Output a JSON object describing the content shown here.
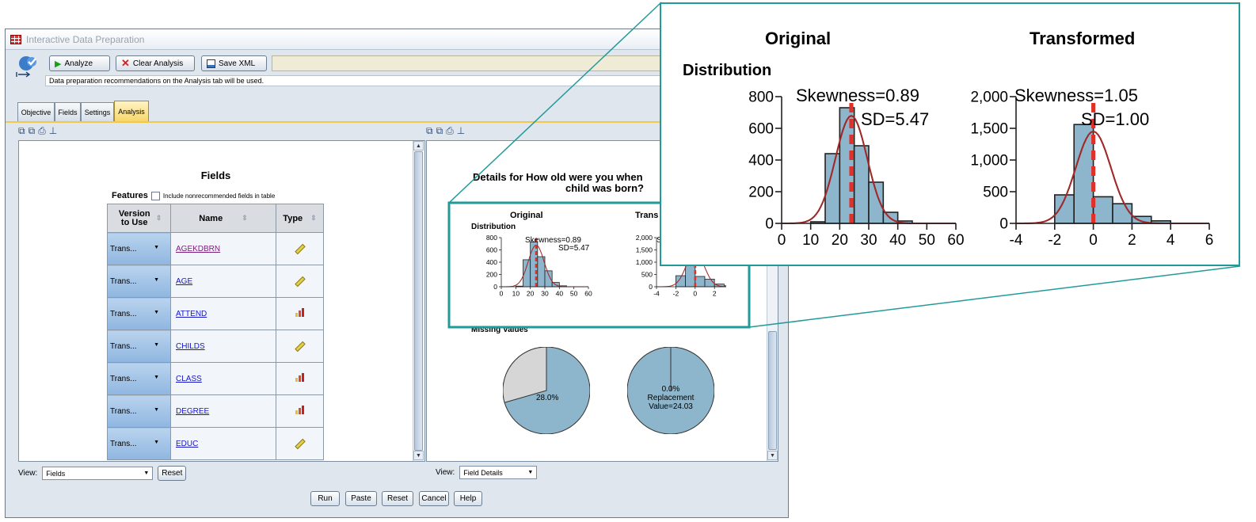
{
  "window": {
    "title": "Interactive Data Preparation"
  },
  "toolbar": {
    "analyze_label": "Analyze",
    "clear_label": "Clear Analysis",
    "save_label": "Save XML",
    "info_text": "Data preparation recommendations on the Analysis tab will be used."
  },
  "tabs": [
    {
      "label": "Objective"
    },
    {
      "label": "Fields"
    },
    {
      "label": "Settings"
    },
    {
      "label": "Analysis",
      "active": true
    }
  ],
  "left_panel": {
    "title": "Fields",
    "features_label": "Features",
    "include_label": "Include nonrecommended fields in table",
    "columns": [
      "Version to Use",
      "Name",
      "Type"
    ],
    "rows": [
      {
        "version": "Trans...",
        "name": "AGEKDBRN",
        "type": "ruler-icon",
        "visited": true
      },
      {
        "version": "Trans...",
        "name": "AGE",
        "type": "ruler-icon"
      },
      {
        "version": "Trans...",
        "name": "ATTEND",
        "type": "bar-chart-icon"
      },
      {
        "version": "Trans...",
        "name": "CHILDS",
        "type": "ruler-icon"
      },
      {
        "version": "Trans...",
        "name": "CLASS",
        "type": "bar-chart-icon"
      },
      {
        "version": "Trans...",
        "name": "DEGREE",
        "type": "bar-chart-icon"
      },
      {
        "version": "Trans...",
        "name": "EDUC",
        "type": "ruler-icon"
      }
    ],
    "view_label": "View:",
    "view_value": "Fields",
    "reset_label": "Reset"
  },
  "right_panel": {
    "details_title_line1": "Details for How old were you when",
    "details_title_line2": "child was born?",
    "original_label": "Original",
    "transformed_label": "Trans",
    "distribution_label": "Distribution",
    "missing_label": "Missing Values",
    "pie_original_label": "28.0%",
    "pie_transformed_label_1": "0.0%",
    "pie_transformed_label_2": "Replacement",
    "pie_transformed_label_3": "Value=24.03",
    "view_label": "View:",
    "view_value": "Field Details"
  },
  "footer": {
    "run": "Run",
    "paste": "Paste",
    "reset": "Reset",
    "cancel": "Cancel",
    "help": "Help"
  },
  "callout": {
    "original_title": "Original",
    "transformed_title": "Transformed",
    "distribution_label": "Distribution",
    "orig_skew": "Skewness=0.89",
    "orig_sd": "SD=5.47",
    "trans_skew": "Skewness=1.05",
    "trans_sd": "SD=1.00"
  },
  "chart_data": [
    {
      "type": "bar",
      "title": "Original",
      "x_ticks": [
        0,
        10,
        20,
        30,
        40,
        50,
        60
      ],
      "y_ticks": [
        0,
        200,
        400,
        600,
        800
      ],
      "bins": [
        [
          10,
          15,
          10
        ],
        [
          15,
          20,
          440
        ],
        [
          20,
          25,
          730
        ],
        [
          25,
          30,
          490
        ],
        [
          30,
          35,
          260
        ],
        [
          35,
          40,
          70
        ],
        [
          40,
          45,
          15
        ]
      ],
      "mean_line": 24,
      "annotations": [
        "Skewness=0.89",
        "SD=5.47"
      ]
    },
    {
      "type": "bar",
      "title": "Transformed",
      "x_ticks": [
        -4,
        -2,
        0,
        2,
        4,
        6
      ],
      "y_ticks": [
        "0",
        "500",
        "1,000",
        "1,500",
        "2,000"
      ],
      "bins": [
        [
          -2,
          -1,
          450
        ],
        [
          -1,
          0,
          1560
        ],
        [
          0,
          1,
          420
        ],
        [
          1,
          2,
          310
        ],
        [
          2,
          3,
          110
        ],
        [
          3,
          4,
          40
        ]
      ],
      "mean_line": 0,
      "annotations": [
        "Skewness=1.05",
        "SD=1.00"
      ]
    },
    {
      "type": "pie",
      "title": "Missing Values",
      "slices": [
        {
          "label": "28.0%",
          "value": 28
        },
        {
          "value": 72
        }
      ]
    },
    {
      "type": "pie",
      "slices": [
        {
          "label": "0.0%",
          "value": 0
        },
        {
          "value": 100
        }
      ]
    }
  ],
  "colors": {
    "accent": "#239a9a",
    "bar": "#8db5cb",
    "curve": "#a02828",
    "mean": "#e0302a",
    "tab_active": "#f7d66a"
  }
}
